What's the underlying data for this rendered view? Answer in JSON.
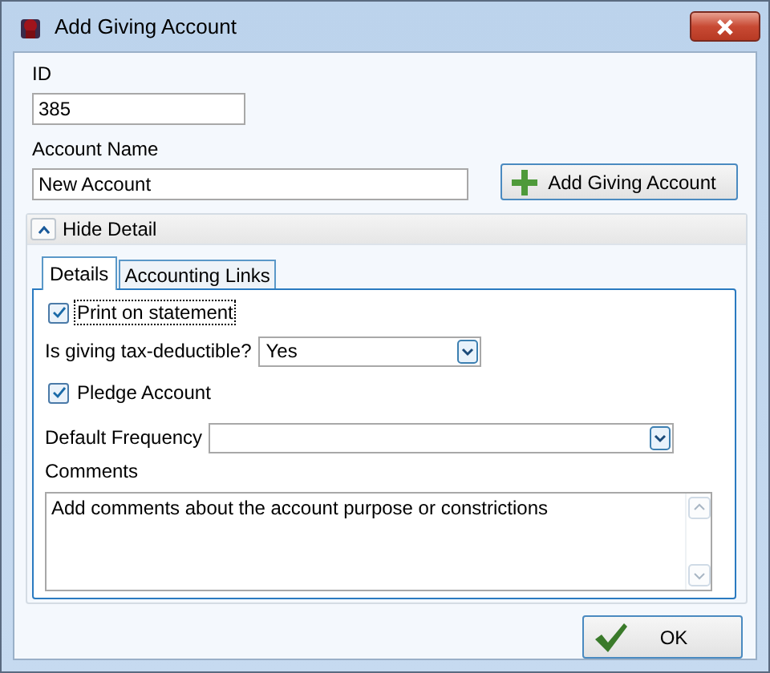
{
  "window": {
    "title": "Add Giving Account"
  },
  "id_field": {
    "label": "ID",
    "value": "385"
  },
  "account_name_field": {
    "label": "Account Name",
    "value": "New Account"
  },
  "add_button": {
    "label": "Add Giving Account"
  },
  "detail": {
    "toggle": {
      "label": "Hide Detail",
      "expanded": true
    },
    "tabs": [
      {
        "label": "Details",
        "selected": true
      },
      {
        "label": "Accounting Links",
        "selected": false
      }
    ],
    "fields": [
      {
        "kind": "checkbox",
        "label": "Print on statement",
        "checked": true,
        "focused": true
      },
      {
        "kind": "select",
        "label": "Is giving tax-deductible?",
        "value": "Yes",
        "wide": false
      },
      {
        "kind": "checkbox",
        "label": "Pledge Account",
        "checked": true,
        "focused": false
      },
      {
        "kind": "select",
        "label": "Default Frequency",
        "wide": true
      },
      {
        "kind": "textarea",
        "label": "Comments",
        "value": "Add comments about the account purpose or constrictions"
      }
    ]
  },
  "ok_button": {
    "label": "OK"
  }
}
